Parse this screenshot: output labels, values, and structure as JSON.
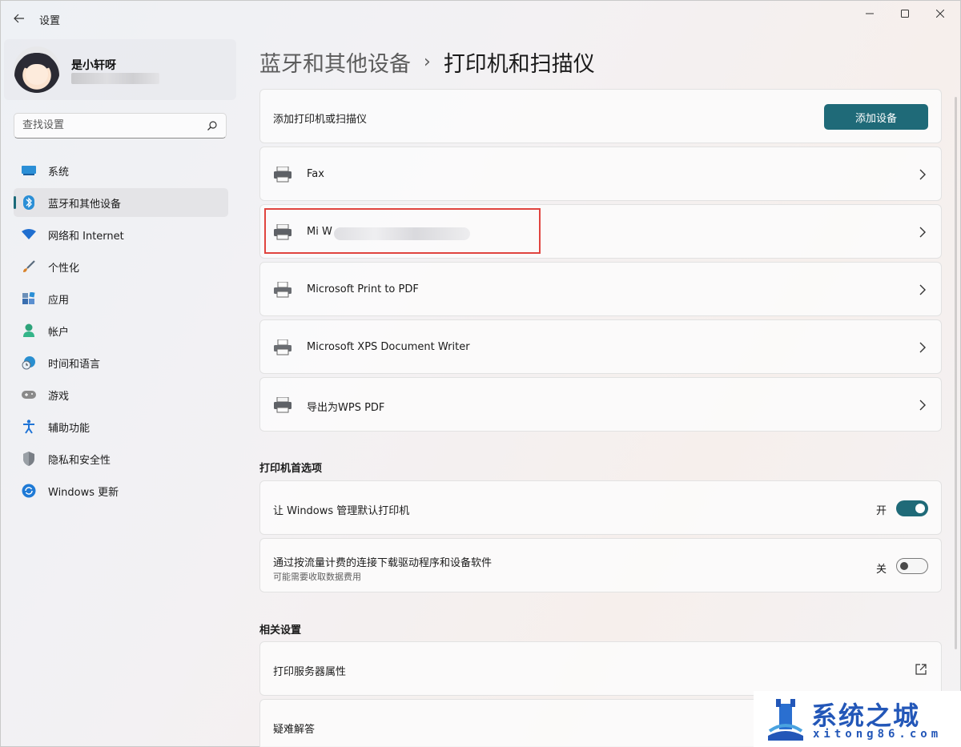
{
  "window": {
    "title": "设置",
    "back_icon": "back-arrow-icon"
  },
  "profile": {
    "name": "是小轩呀"
  },
  "search": {
    "placeholder": "查找设置"
  },
  "nav": {
    "items": [
      {
        "label": "系统",
        "icon": "monitor-icon",
        "color": "#2b8fd6"
      },
      {
        "label": "蓝牙和其他设备",
        "icon": "bluetooth-icon",
        "color": "#2b8fd6",
        "active": true
      },
      {
        "label": "网络和 Internet",
        "icon": "wifi-icon",
        "color": "#1f6fd0"
      },
      {
        "label": "个性化",
        "icon": "brush-icon",
        "color": "#d8822a"
      },
      {
        "label": "应用",
        "icon": "apps-icon",
        "color": "#3a6fb0"
      },
      {
        "label": "帐户",
        "icon": "person-icon",
        "color": "#2ea37a"
      },
      {
        "label": "时间和语言",
        "icon": "clock-globe-icon",
        "color": "#2a8fd0"
      },
      {
        "label": "游戏",
        "icon": "gamepad-icon",
        "color": "#8a8a8a"
      },
      {
        "label": "辅助功能",
        "icon": "accessibility-icon",
        "color": "#1f74d6"
      },
      {
        "label": "隐私和安全性",
        "icon": "shield-icon",
        "color": "#7a7f86"
      },
      {
        "label": "Windows 更新",
        "icon": "update-icon",
        "color": "#1f7ad6"
      }
    ]
  },
  "breadcrumb": {
    "parent": "蓝牙和其他设备",
    "separator": "›",
    "current": "打印机和扫描仪"
  },
  "add_printer": {
    "label": "添加打印机或扫描仪",
    "button": "添加设备"
  },
  "printers": [
    {
      "name": "Fax"
    },
    {
      "name": "Mi W"
    },
    {
      "name": "Microsoft Print to PDF"
    },
    {
      "name": "Microsoft XPS Document Writer"
    },
    {
      "name": "导出为WPS PDF"
    }
  ],
  "preferences": {
    "heading": "打印机首选项",
    "items": [
      {
        "label": "让 Windows 管理默认打印机",
        "state": "开",
        "on": true
      },
      {
        "label": "通过按流量计费的连接下载驱动程序和设备软件",
        "sublabel": "可能需要收取数据费用",
        "state": "关",
        "on": false
      }
    ]
  },
  "related": {
    "heading": "相关设置",
    "items": [
      {
        "label": "打印服务器属性",
        "icon": "open-external-icon"
      },
      {
        "label": "疑难解答"
      }
    ]
  },
  "watermark": {
    "title": "系统之城",
    "url": "xitong86.com"
  },
  "colors": {
    "accent": "#1f6a78",
    "highlight_box": "#e0443f",
    "watermark": "#2357b8"
  }
}
